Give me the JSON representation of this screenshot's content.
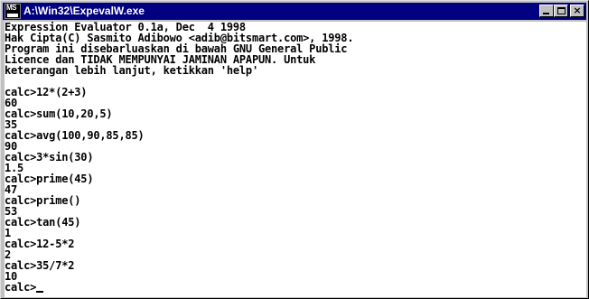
{
  "window": {
    "title": "A:\\Win32\\ExpevalW.exe",
    "icon_text": "MS",
    "buttons": {
      "minimize": "minimize-icon",
      "maximize": "maximize-icon",
      "close": "×"
    }
  },
  "console": {
    "lines": [
      "Expression Evaluator 0.1a, Dec  4 1998",
      "Hak Cipta(C) Sasmito Adibowo <adib@bitsmart.com>, 1998.",
      "Program ini disebarluaskan di bawah GNU General Public",
      "Licence dan TIDAK MEMPUNYAI JAMINAN APAPUN. Untuk",
      "keterangan lebih lanjut, ketikkan 'help'",
      "",
      "calc>12*(2+3)",
      "60",
      "calc>sum(10,20,5)",
      "35",
      "calc>avg(100,90,85,85)",
      "90",
      "calc>3*sin(30)",
      "1.5",
      "calc>prime(45)",
      "47",
      "calc>prime()",
      "53",
      "calc>tan(45)",
      "1",
      "calc>12-5*2",
      "2",
      "calc>35/7*2",
      "10"
    ],
    "prompt": "calc>"
  },
  "colors": {
    "title_bg": "#000080",
    "console_bg": "#ffffff",
    "console_fg": "#000000"
  }
}
